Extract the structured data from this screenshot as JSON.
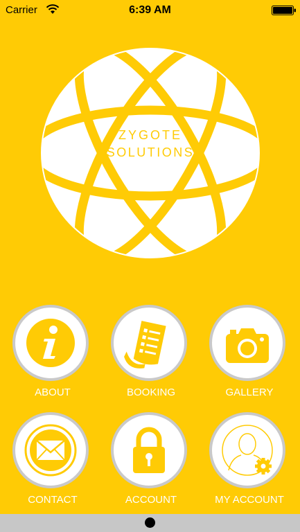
{
  "status_bar": {
    "carrier": "Carrier",
    "time": "6:39 AM"
  },
  "logo": {
    "line1": "ZYGOTE",
    "line2": "SOLUTIONS"
  },
  "menu": {
    "about": "ABOUT",
    "booking": "BOOKING",
    "gallery": "GALLERY",
    "contact": "CONTACT",
    "account": "ACCOUNT",
    "my_account": "MY ACCOUNT"
  },
  "colors": {
    "background": "#FFCB05",
    "circle_border": "#C9C9C9",
    "icon": "#FFCB05",
    "label": "#FFFFFF"
  },
  "icons": {
    "about": "info-icon",
    "booking": "document-list-icon",
    "gallery": "camera-icon",
    "contact": "envelope-icon",
    "account": "padlock-icon",
    "my_account": "user-gear-icon"
  }
}
